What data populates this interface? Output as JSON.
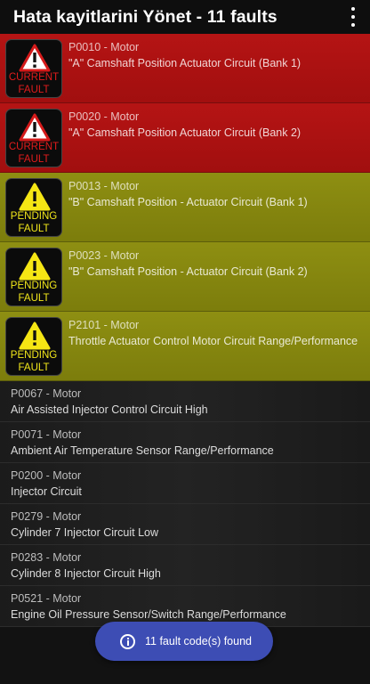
{
  "appbar": {
    "title": "Hata kayitlarini Yönet - 11 faults",
    "menu_icon": "more-vert-icon"
  },
  "faults": [
    {
      "status": "current",
      "badge_line1": "CURRENT",
      "badge_line2": "FAULT",
      "code": "P0010 - Motor",
      "description": "\"A\" Camshaft Position Actuator Circuit (Bank 1)"
    },
    {
      "status": "current",
      "badge_line1": "CURRENT",
      "badge_line2": "FAULT",
      "code": "P0020 - Motor",
      "description": "\"A\" Camshaft Position Actuator Circuit (Bank 2)"
    },
    {
      "status": "pending",
      "badge_line1": "PENDING",
      "badge_line2": "FAULT",
      "code": "P0013 - Motor",
      "description": "\"B\" Camshaft Position - Actuator Circuit (Bank 1)"
    },
    {
      "status": "pending",
      "badge_line1": "PENDING",
      "badge_line2": "FAULT",
      "code": "P0023 - Motor",
      "description": "\"B\" Camshaft Position - Actuator Circuit (Bank 2)"
    },
    {
      "status": "pending",
      "badge_line1": "PENDING",
      "badge_line2": "FAULT",
      "code": "P2101 - Motor",
      "description": "Throttle Actuator Control Motor Circuit Range/Performance"
    }
  ],
  "other_faults": [
    {
      "code": "P0067 - Motor",
      "description": "Air Assisted Injector Control Circuit High"
    },
    {
      "code": "P0071 - Motor",
      "description": "Ambient Air Temperature Sensor Range/Performance"
    },
    {
      "code": "P0200 - Motor",
      "description": "Injector Circuit"
    },
    {
      "code": "P0279 - Motor",
      "description": "Cylinder 7 Injector Circuit Low"
    },
    {
      "code": "P0283 - Motor",
      "description": "Cylinder 8 Injector Circuit High"
    },
    {
      "code": "P0521 - Motor",
      "description": "Engine Oil Pressure Sensor/Switch Range/Performance"
    }
  ],
  "snackbar": {
    "text": "11 fault code(s) found",
    "icon": "info-icon"
  },
  "colors": {
    "current_bg": "#a80f0f",
    "pending_bg": "#858610",
    "current_text": "#e21c1c",
    "pending_text": "#f2e71a",
    "snackbar_bg": "#3d4db4"
  }
}
